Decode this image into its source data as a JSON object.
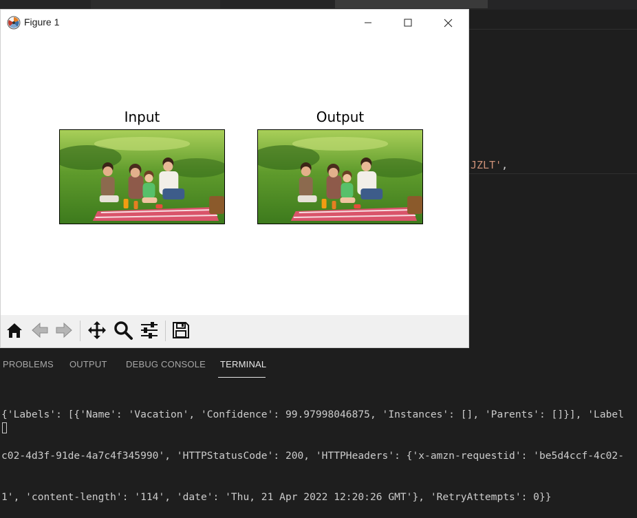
{
  "window": {
    "title": "Figure 1",
    "minimize_label": "Minimize",
    "maximize_label": "Maximize",
    "close_label": "Close"
  },
  "figure": {
    "axes": [
      {
        "title": "Input",
        "image": "family-picnic-photo"
      },
      {
        "title": "Output",
        "image": "family-picnic-photo"
      }
    ]
  },
  "toolbar": {
    "buttons": [
      {
        "icon": "home-icon",
        "tooltip": "Home"
      },
      {
        "icon": "back-arrow-icon",
        "tooltip": "Back"
      },
      {
        "icon": "forward-arrow-icon",
        "tooltip": "Forward"
      },
      {
        "icon": "pan-icon",
        "tooltip": "Pan"
      },
      {
        "icon": "zoom-icon",
        "tooltip": "Zoom"
      },
      {
        "icon": "subplots-icon",
        "tooltip": "Configure subplots"
      },
      {
        "icon": "save-icon",
        "tooltip": "Save"
      }
    ]
  },
  "editor": {
    "code_fragment": "JZLT'",
    "code_punct": ","
  },
  "panel": {
    "tabs": [
      "PROBLEMS",
      "OUTPUT",
      "DEBUG CONSOLE",
      "TERMINAL"
    ],
    "active_tab": "TERMINAL"
  },
  "terminal": {
    "lines": [
      "{'Labels': [{'Name': 'Vacation', 'Confidence': 99.97998046875, 'Instances': [], 'Parents': []}], 'Label",
      "c02-4d3f-91de-4a7c4f345990', 'HTTPStatusCode': 200, 'HTTPHeaders': {'x-amzn-requestid': 'be5d4ccf-4c02-",
      "1', 'content-length': '114', 'date': 'Thu, 21 Apr 2022 12:20:26 GMT'}, 'RetryAttempts': 0}}"
    ]
  },
  "colors": {
    "editor_bg": "#1e1e1e",
    "string_color": "#ce9178",
    "terminal_text": "#cccccc",
    "toolbar_bg": "#f0f0f0"
  }
}
